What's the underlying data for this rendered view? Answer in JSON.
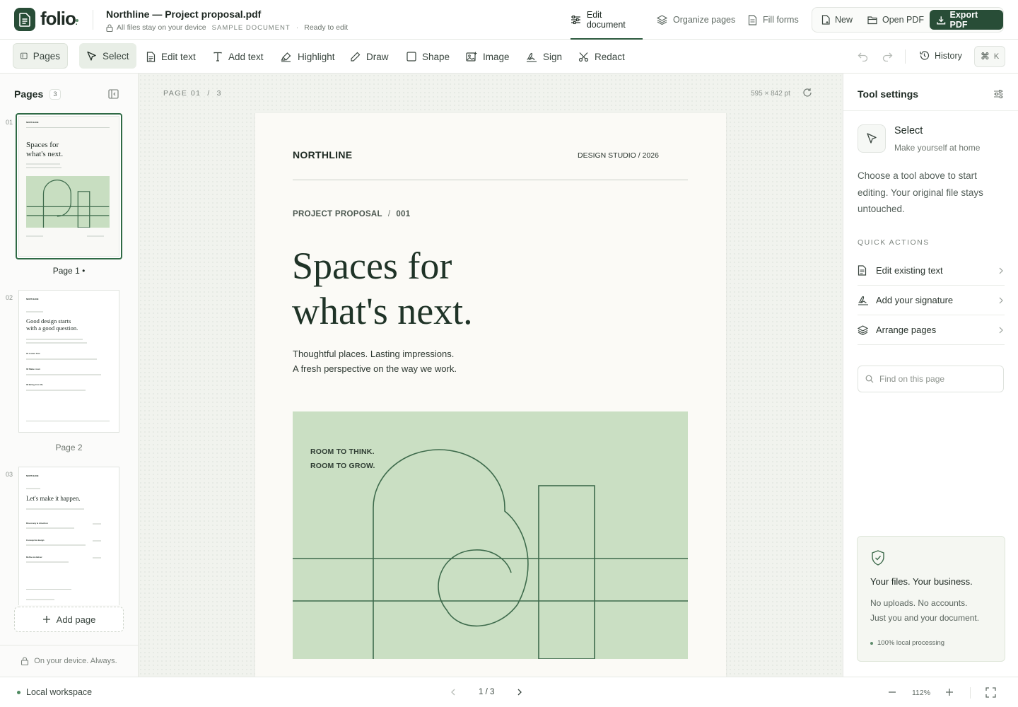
{
  "app": {
    "name": "folio"
  },
  "document": {
    "title": "Northline — Project proposal.pdf",
    "privacy_note": "All files stay on your device",
    "sample_badge": "SAMPLE DOCUMENT",
    "status": "Ready to edit"
  },
  "nav": {
    "tabs": [
      {
        "label": "Edit document",
        "icon": "sliders-icon",
        "active": true
      },
      {
        "label": "Organize pages",
        "icon": "layers-icon",
        "active": false
      },
      {
        "label": "Fill forms",
        "icon": "form-icon",
        "active": false
      }
    ]
  },
  "actions": {
    "new": "New",
    "open": "Open PDF",
    "export": "Export PDF"
  },
  "toolbar": {
    "pages": "Pages",
    "tools": [
      {
        "label": "Select",
        "icon": "cursor-icon",
        "active": true
      },
      {
        "label": "Edit text",
        "icon": "document-icon"
      },
      {
        "label": "Add text",
        "icon": "text-icon"
      },
      {
        "label": "Highlight",
        "icon": "highlighter-icon"
      },
      {
        "label": "Draw",
        "icon": "pen-icon"
      },
      {
        "label": "Shape",
        "icon": "square-icon"
      },
      {
        "label": "Image",
        "icon": "image-icon"
      },
      {
        "label": "Sign",
        "icon": "signature-icon"
      },
      {
        "label": "Redact",
        "icon": "scissors-icon"
      }
    ],
    "history": "History",
    "shortcut_key": "K"
  },
  "sidebar": {
    "title": "Pages",
    "count": "3",
    "pages": [
      {
        "number": "01",
        "label": "Page 1 •",
        "active": true
      },
      {
        "number": "02",
        "label": "Page 2",
        "active": false
      },
      {
        "number": "03",
        "label": "",
        "active": false
      }
    ],
    "add_page": "Add page",
    "footer": "On your device. Always."
  },
  "canvas": {
    "page_indicator": "PAGE 01",
    "page_total": "3",
    "page_size": "595 × 842 pt"
  },
  "page1": {
    "brand": "NORTHLINE",
    "studio": "DESIGN STUDIO / 2026",
    "kicker": "PROJECT PROPOSAL",
    "kicker_num": "001",
    "headline_line1": "Spaces for",
    "headline_line2": "what's next.",
    "sub_line1": "Thoughtful places. Lasting impressions.",
    "sub_line2": "A fresh perspective on the way we work.",
    "art_line1": "ROOM TO THINK.",
    "art_line2": "ROOM TO GROW.",
    "art_color": "#cadfc3"
  },
  "thumbs": {
    "p2_title_1": "Good design starts",
    "p2_title_2": "with a good question.",
    "p2_items": [
      "01  Listen first",
      "02  Make room",
      "03  Bring it to life"
    ],
    "p3_title": "Let's make it happen.",
    "p3_items": [
      "Discovery & direction",
      "Concept & design",
      "Refine & deliver"
    ]
  },
  "right_panel": {
    "title": "Tool settings",
    "tool_name": "Select",
    "tool_desc": "Make yourself at home",
    "help": "Choose a tool above to start editing. Your original file stays untouched.",
    "quick_actions_title": "QUICK ACTIONS",
    "quick_actions": [
      {
        "label": "Edit existing text",
        "icon": "document-icon"
      },
      {
        "label": "Add your signature",
        "icon": "signature-icon"
      },
      {
        "label": "Arrange pages",
        "icon": "layers-icon"
      }
    ],
    "find_placeholder": "Find on this page",
    "trust_title": "Your files. Your business.",
    "trust_line1": "No uploads. No accounts.",
    "trust_line2": "Just you and your document.",
    "trust_badge": "100% local processing"
  },
  "statusbar": {
    "workspace": "Local workspace",
    "page": "1 / 3",
    "zoom": "112%"
  },
  "colors": {
    "accent": "#284d37",
    "art_green": "#cadfc3",
    "canvas_bg": "#f1f3ee"
  }
}
